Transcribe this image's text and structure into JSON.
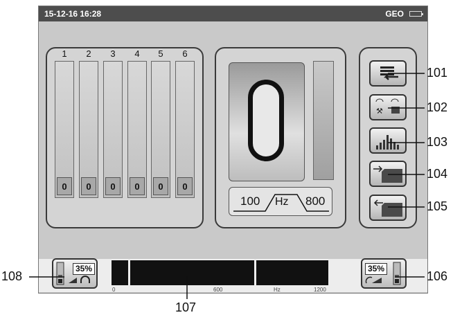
{
  "status_bar": {
    "datetime": "15-12-16 16:28",
    "device": "GEO",
    "battery_icon": "battery-icon"
  },
  "channels": [
    {
      "number": "1",
      "value": "0"
    },
    {
      "number": "2",
      "value": "0"
    },
    {
      "number": "3",
      "value": "0"
    },
    {
      "number": "4",
      "value": "0"
    },
    {
      "number": "5",
      "value": "0"
    },
    {
      "number": "6",
      "value": "0"
    }
  ],
  "frequency_range": {
    "low": "100",
    "unit": "Hz",
    "high": "800"
  },
  "buttons": [
    {
      "icon": "list-return-icon",
      "callout": "101"
    },
    {
      "icon": "settings-icon",
      "callout": "102"
    },
    {
      "icon": "spectrum-icon",
      "callout": "103"
    },
    {
      "icon": "folder-in-icon",
      "callout": "104"
    },
    {
      "icon": "folder-out-icon",
      "callout": "105"
    }
  ],
  "spectrum": {
    "ticks": [
      "0",
      "600",
      "Hz",
      "1200"
    ],
    "callout": "107"
  },
  "volume_left": {
    "percent": "35%",
    "icon": "headphone-icon",
    "callout": "108"
  },
  "volume_right": {
    "percent": "35%",
    "icon": "sensor-icon",
    "callout": "106"
  },
  "colors": {
    "screen_bg": "#c9c9c9",
    "topbar": "#4d4d4d",
    "spectrum_bg": "#111111"
  }
}
